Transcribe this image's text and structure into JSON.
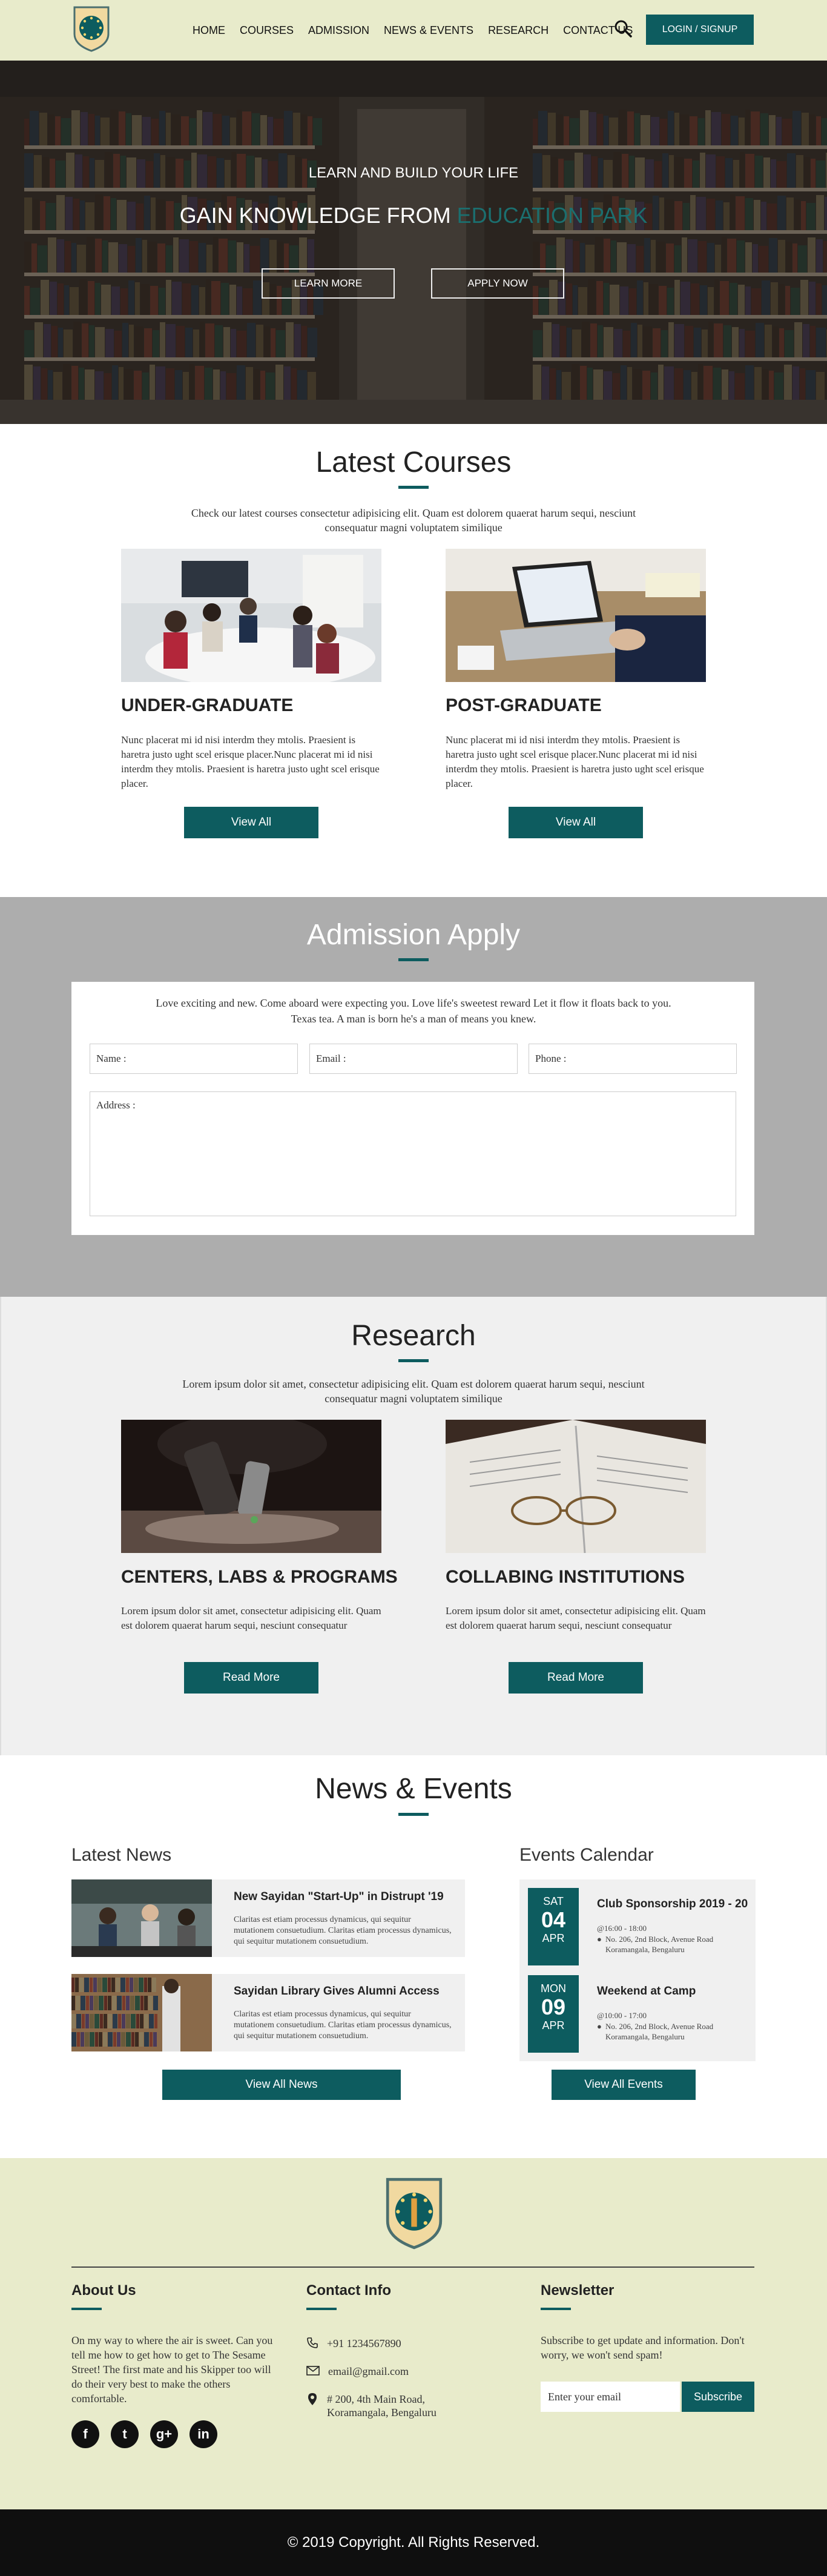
{
  "header": {
    "nav": [
      "HOME",
      "COURSES",
      "ADMISSION",
      "NEWS & EVENTS",
      "RESEARCH",
      "CONTACT US"
    ],
    "login_label": "LOGIN / SIGNUP"
  },
  "hero": {
    "subtitle": "LEARN AND BUILD YOUR LIFE",
    "title_main": "GAIN KNOWLEDGE FROM ",
    "title_highlight": "EDUCATION PARK",
    "learn_more": "LEARN MORE",
    "apply_now": "APPLY NOW"
  },
  "courses": {
    "title": "Latest Courses",
    "intro": "Check our latest courses consectetur adipisicing elit. Quam est dolorem quaerat harum sequi, nesciunt consequatur magni voluptatem similique",
    "cards": [
      {
        "title": "UNDER-GRADUATE",
        "text": "Nunc placerat mi id nisi interdm they mtolis. Praesient is haretra justo ught scel erisque placer.Nunc placerat mi id nisi interdm they mtolis. Praesient is haretra justo ught scel erisque placer.",
        "button": "View All"
      },
      {
        "title": "POST-GRADUATE",
        "text": "Nunc placerat mi id nisi interdm they mtolis. Praesient is haretra justo ught scel erisque placer.Nunc placerat mi id nisi interdm they mtolis. Praesient is haretra justo ught scel erisque placer.",
        "button": "View All"
      }
    ]
  },
  "admission": {
    "title": "Admission Apply",
    "intro": "Love exciting and new. Come aboard were expecting you. Love life's sweetest reward Let it flow it floats back to you. Texas tea. A man is born he's a man of means you knew.",
    "name_placeholder": "Name :",
    "email_placeholder": "Email :",
    "phone_placeholder": "Phone :",
    "address_placeholder": "Address :"
  },
  "research": {
    "title": "Research",
    "intro": "Lorem ipsum dolor sit amet, consectetur adipisicing elit. Quam est dolorem quaerat harum sequi, nesciunt consequatur magni voluptatem similique",
    "cards": [
      {
        "title": "CENTERS, LABS & PROGRAMS",
        "text": "Lorem ipsum dolor sit amet, consectetur adipisicing elit. Quam est dolorem quaerat harum sequi, nesciunt consequatur",
        "button": "Read More"
      },
      {
        "title": "COLLABING INSTITUTIONS",
        "text": "Lorem ipsum dolor sit amet, consectetur adipisicing elit. Quam est dolorem quaerat harum sequi, nesciunt consequatur",
        "button": "Read More"
      }
    ]
  },
  "news": {
    "title": "News & Events",
    "latest_title": "Latest News",
    "events_title": "Events Calendar",
    "items": [
      {
        "title": "New Sayidan \"Start-Up\" in Distrupt '19",
        "text": "Claritas est etiam processus dynamicus, qui sequitur mutationem consuetudium. Claritas etiam processus dynamicus, qui sequitur mutationem consuetudium."
      },
      {
        "title": "Sayidan Library Gives Alumni Access",
        "text": "Claritas est etiam processus dynamicus, qui sequitur mutationem consuetudium. Claritas etiam processus dynamicus, qui sequitur mutationem consuetudium."
      }
    ],
    "events": [
      {
        "day": "SAT",
        "date": "04",
        "month": "APR",
        "title": "Club Sponsorship 2019 - 20",
        "time": "@16:00 - 18:00",
        "place": "No. 206, 2nd Block, Avenue Road Koramangala, Bengaluru"
      },
      {
        "day": "MON",
        "date": "09",
        "month": "APR",
        "title": "Weekend at Camp",
        "time": "@10:00 - 17:00",
        "place": "No. 206, 2nd Block, Avenue Road Koramangala, Bengaluru"
      }
    ],
    "view_news": "View All News",
    "view_events": "View All Events"
  },
  "footer": {
    "about_title": "About Us",
    "about_text": "On my way to where the air is sweet. Can you tell me how to get how to get to The Sesame Street! The first mate and his Skipper too will do their very best to make the others comfortable.",
    "contact_title": "Contact Info",
    "phone": "+91 1234567890",
    "email": "email@gmail.com",
    "address_line1": "# 200, 4th Main Road,",
    "address_line2": "Koramangala, Bengaluru",
    "newsletter_title": "Newsletter",
    "newsletter_text": "Subscribe to get update and information. Don't worry, we won't send spam!",
    "email_placeholder": "Enter your email",
    "subscribe": "Subscribe",
    "social": [
      "f",
      "t",
      "g+",
      "in"
    ],
    "copyright": "© 2019 Copyright. All Rights Reserved."
  },
  "colors": {
    "accent": "#0d5c5f",
    "header_bg": "#e8ebcb"
  }
}
